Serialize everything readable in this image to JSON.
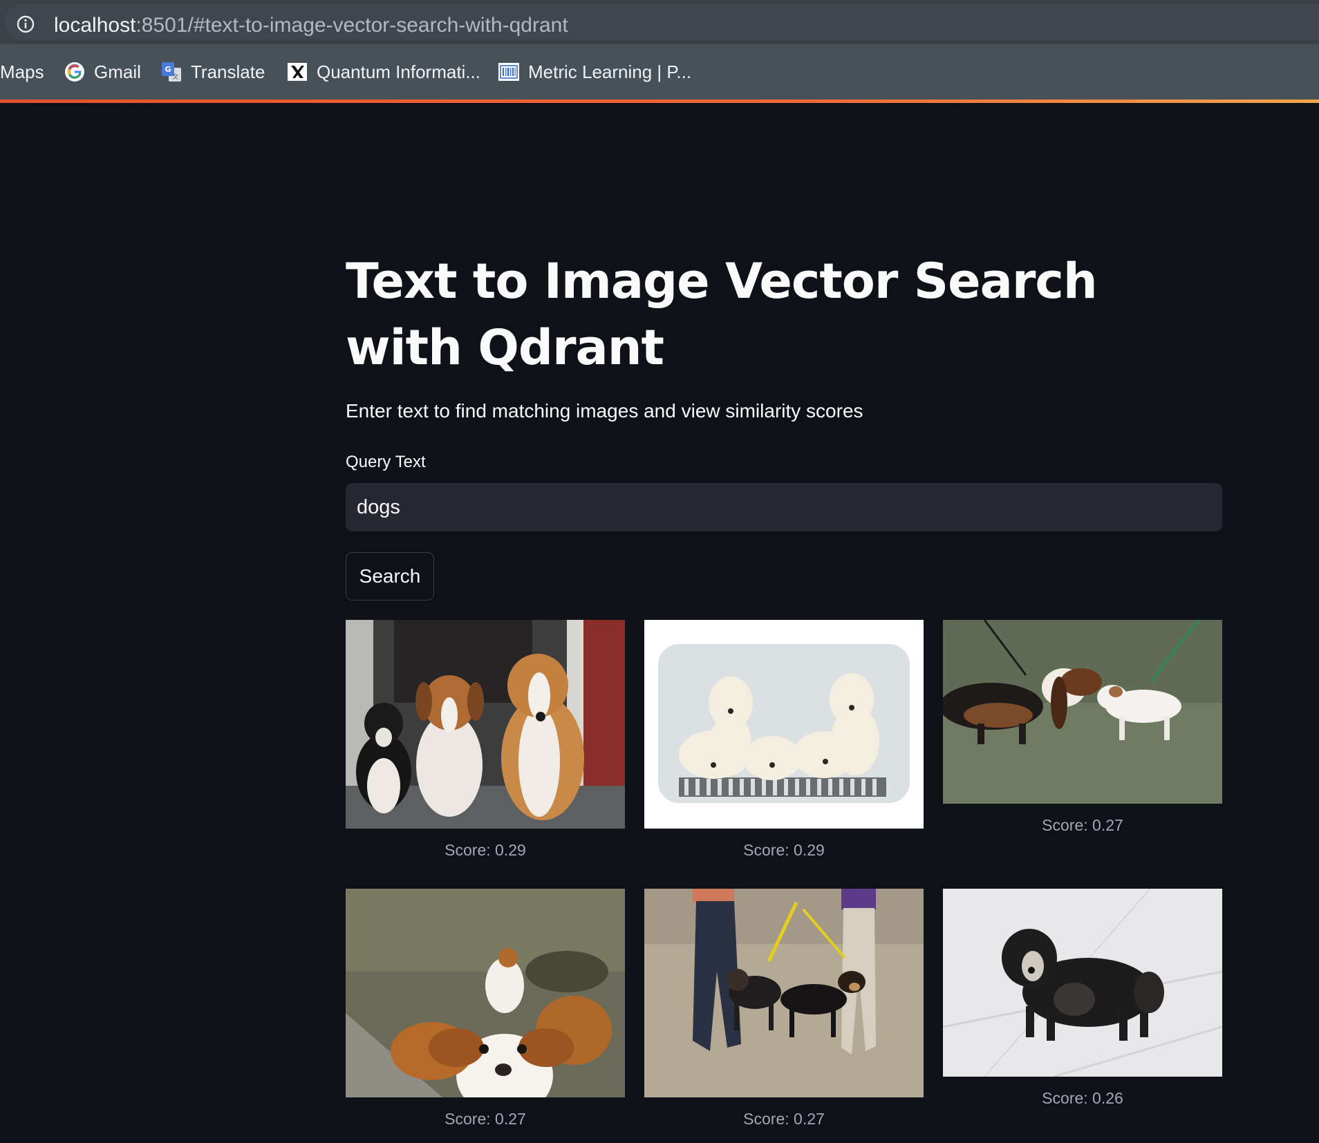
{
  "browser": {
    "url_host": "localhost",
    "url_path": ":8501/#text-to-image-vector-search-with-qdrant",
    "bookmarks": [
      {
        "label": "Maps",
        "icon": "maps-icon"
      },
      {
        "label": "Gmail",
        "icon": "google-icon"
      },
      {
        "label": "Translate",
        "icon": "translate-icon"
      },
      {
        "label": "Quantum Informati...",
        "icon": "x-logo-icon"
      },
      {
        "label": "Metric Learning | P...",
        "icon": "barcode-icon"
      }
    ]
  },
  "app": {
    "title": "Text to Image Vector Search with Qdrant",
    "subtitle": "Enter text to find matching images and view similarity scores",
    "query_label": "Query Text",
    "query_value": "dogs",
    "search_label": "Search"
  },
  "results": [
    {
      "score_label": "Score: 0.29",
      "image": "three-dogs-doorway"
    },
    {
      "score_label": "Score: 0.29",
      "image": "labrador-puppies"
    },
    {
      "score_label": "Score: 0.27",
      "image": "basset-and-puppy-on-grass"
    },
    {
      "score_label": "Score: 0.27",
      "image": "spaniel-closeup"
    },
    {
      "score_label": "Score: 0.27",
      "image": "dogs-on-leash-beach"
    },
    {
      "score_label": "Score: 0.26",
      "image": "shaggy-dog-in-snow"
    }
  ],
  "colors": {
    "background": "#0e1117",
    "input_background": "#262730",
    "text": "#fafafa",
    "score_text": "#a3a8b4",
    "loadbar": "#f06838"
  }
}
